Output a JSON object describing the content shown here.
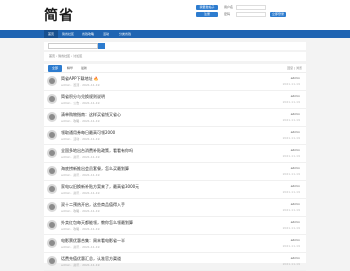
{
  "header": {
    "logo": "简省",
    "tagline": "",
    "publish_button": "我要发帖子",
    "register_button": "注册",
    "login_button": "立即登录",
    "user_label": "用户名",
    "pass_label": "密码"
  },
  "nav": {
    "items": [
      {
        "label": "首页"
      },
      {
        "label": "简省社区"
      },
      {
        "label": "省钱攻略"
      },
      {
        "label": "活动"
      },
      {
        "label": "分类省钱"
      }
    ]
  },
  "search": {
    "placeholder": "请输入搜索内容"
  },
  "breadcrumb": "首页 › 简省社区 › 讨论区",
  "tabs": {
    "items": [
      {
        "label": "全部"
      },
      {
        "label": "精华"
      },
      {
        "label": "最新"
      }
    ],
    "right": "回复 | 浏览"
  },
  "threads": [
    {
      "title": "简省APP下载地址 🔥",
      "meta": "admin · 置顶 · 2021-11-19",
      "user": "admin",
      "time": "2021-11-19"
    },
    {
      "title": "简省积分与兑换规则说明",
      "meta": "admin · 公告 · 2021-11-19",
      "user": "admin",
      "time": "2021-11-19"
    },
    {
      "title": "清单购物指南：这样买省钱又省心",
      "meta": "admin · 攻略 · 2021-11-19",
      "user": "admin",
      "time": "2021-11-19"
    },
    {
      "title": "领取通用券每日最高可领2000",
      "meta": "admin · 活动 · 2021-11-19",
      "user": "admin",
      "time": "2021-11-19"
    },
    {
      "title": "全国多地出台消费补贴政策，看看有你吗",
      "meta": "admin · 资讯 · 2021-11-19",
      "user": "admin",
      "time": "2021-11-19"
    },
    {
      "title": "海底捞新推出会员套餐，怎么买最划算",
      "meta": "admin · 资讯 · 2021-11-19",
      "user": "admin",
      "time": "2021-11-19"
    },
    {
      "title": "家电以旧换新补贴方案来了，最高省3000元",
      "meta": "admin · 资讯 · 2021-11-19",
      "user": "admin",
      "time": "2021-11-19"
    },
    {
      "title": "双十二预热开启，这些商品值得入手",
      "meta": "admin · 攻略 · 2021-11-19",
      "user": "admin",
      "time": "2021-11-19"
    },
    {
      "title": "外卖红包每天都能领，教你怎么领最划算",
      "meta": "admin · 攻略 · 2021-11-19",
      "user": "admin",
      "time": "2021-11-19"
    },
    {
      "title": "电影票优惠合集：周末看电影省一半",
      "meta": "admin · 资讯 · 2021-11-19",
      "user": "admin",
      "time": "2021-11-19"
    },
    {
      "title": "话费充值优惠汇总，认准官方渠道",
      "meta": "admin · 资讯 · 2021-11-19",
      "user": "admin",
      "time": "2021-11-19"
    }
  ]
}
